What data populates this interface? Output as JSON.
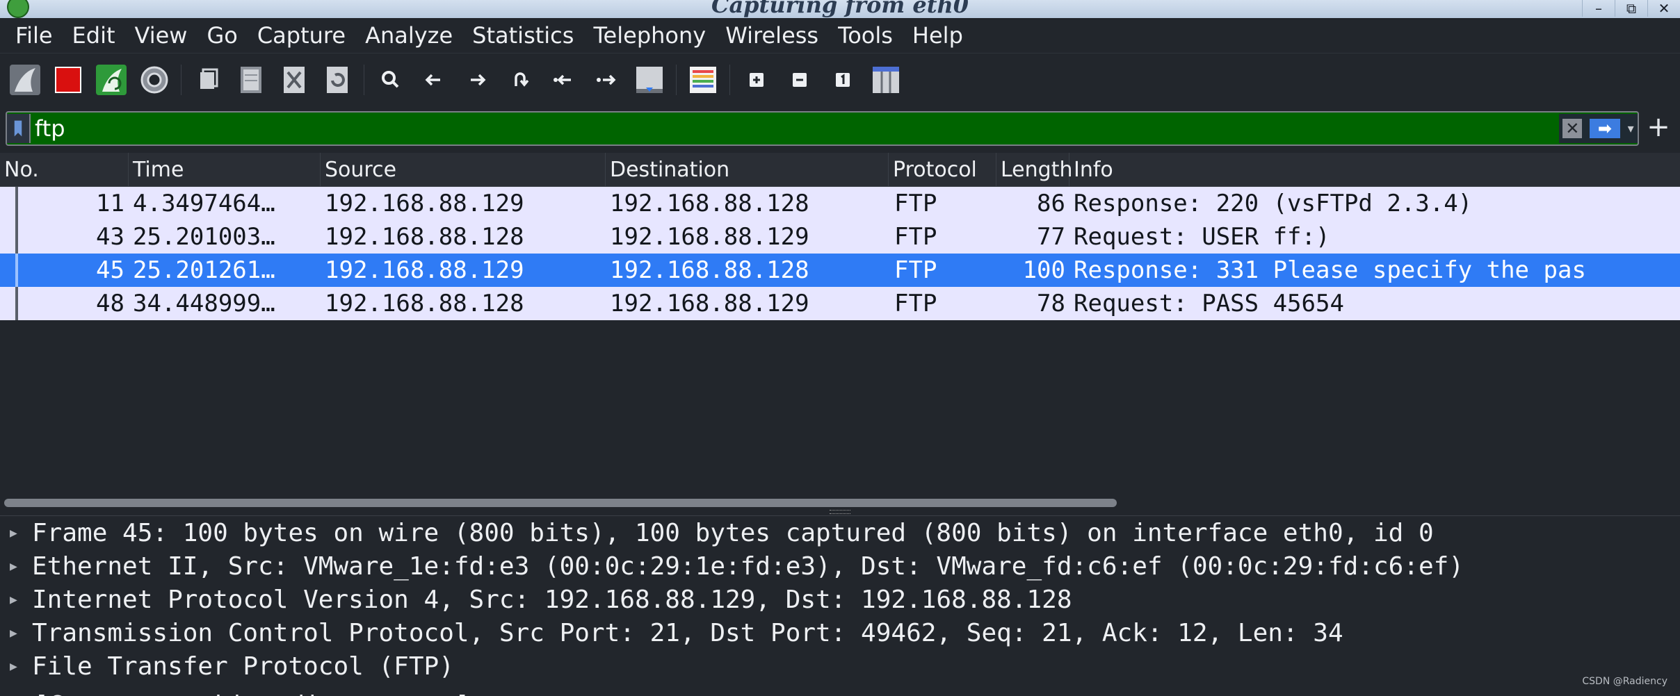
{
  "window": {
    "title": "Capturing from eth0",
    "buttons": [
      "–",
      "⧉",
      "✕"
    ]
  },
  "menubar": {
    "items": [
      "File",
      "Edit",
      "View",
      "Go",
      "Capture",
      "Analyze",
      "Statistics",
      "Telephony",
      "Wireless",
      "Tools",
      "Help"
    ]
  },
  "toolbar": {
    "icons": [
      "start-capture-icon",
      "stop-capture-icon",
      "restart-capture-icon",
      "capture-options-icon",
      "open-file-icon",
      "save-file-icon",
      "close-file-icon",
      "reload-file-icon",
      "find-packet-icon",
      "go-back-icon",
      "go-forward-icon",
      "go-to-packet-icon",
      "go-first-packet-icon",
      "go-last-packet-icon",
      "autoscroll-icon",
      "colorize-icon",
      "zoom-in-icon",
      "zoom-out-icon",
      "normal-size-icon",
      "resize-columns-icon"
    ]
  },
  "filter": {
    "value": "ftp",
    "clear_label": "✕",
    "apply_label": "➡",
    "add_label": "+"
  },
  "packet_list": {
    "columns": [
      "No.",
      "Time",
      "Source",
      "Destination",
      "Protocol",
      "Length",
      "Info"
    ],
    "rows": [
      {
        "no": "11",
        "time": "4.3497464…",
        "src": "192.168.88.129",
        "dst": "192.168.88.128",
        "proto": "FTP",
        "len": "86",
        "info": "Response: 220 (vsFTPd 2.3.4)"
      },
      {
        "no": "43",
        "time": "25.201003…",
        "src": "192.168.88.128",
        "dst": "192.168.88.129",
        "proto": "FTP",
        "len": "77",
        "info": "Request: USER ff:)"
      },
      {
        "no": "45",
        "time": "25.201261…",
        "src": "192.168.88.129",
        "dst": "192.168.88.128",
        "proto": "FTP",
        "len": "100",
        "info": "Response: 331 Please specify the pas"
      },
      {
        "no": "48",
        "time": "34.448999…",
        "src": "192.168.88.128",
        "dst": "192.168.88.129",
        "proto": "FTP",
        "len": "78",
        "info": "Request: PASS 45654"
      }
    ],
    "selected_index": 2
  },
  "details": {
    "lines": [
      "Frame 45: 100 bytes on wire (800 bits), 100 bytes captured (800 bits) on interface eth0, id 0",
      "Ethernet II, Src: VMware_1e:fd:e3 (00:0c:29:1e:fd:e3), Dst: VMware_fd:c6:ef (00:0c:29:fd:c6:ef)",
      "Internet Protocol Version 4, Src: 192.168.88.129, Dst: 192.168.88.128",
      "Transmission Control Protocol, Src Port: 21, Dst Port: 49462, Seq: 21, Ack: 12, Len: 34",
      "File Transfer Protocol (FTP)"
    ],
    "partial_line": "[Current working directory: ]"
  },
  "watermark": "CSDN @Radiency",
  "colors": {
    "filter_valid": "#006400",
    "row_bg": "#e7e6ff",
    "row_selected": "#2f7bf5",
    "background": "#22262c"
  }
}
